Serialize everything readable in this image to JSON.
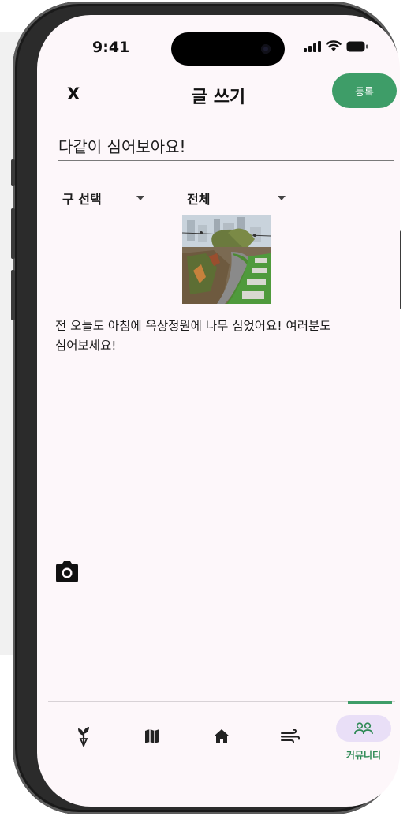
{
  "status_bar": {
    "time": "9:41"
  },
  "header": {
    "close_label": "X",
    "title": "글 쓰기",
    "submit_label": "등록"
  },
  "post": {
    "title_value": "다같이 심어보아요!",
    "district_select": "구 선택",
    "category_select": "전체",
    "body_text": "전 오늘도 아침에 옥상정원에 나무 심었어요! 여러분도 심어보세요!"
  },
  "bottom_nav": {
    "items": [
      {
        "icon": "sprout-icon"
      },
      {
        "icon": "map-icon"
      },
      {
        "icon": "home-icon"
      },
      {
        "icon": "wind-icon"
      },
      {
        "icon": "community-icon",
        "label": "커뮤니티",
        "active": true
      }
    ]
  },
  "colors": {
    "accent": "#3e9d68",
    "active_pill": "#e9dff7",
    "screen_bg": "#fdf7fa"
  }
}
